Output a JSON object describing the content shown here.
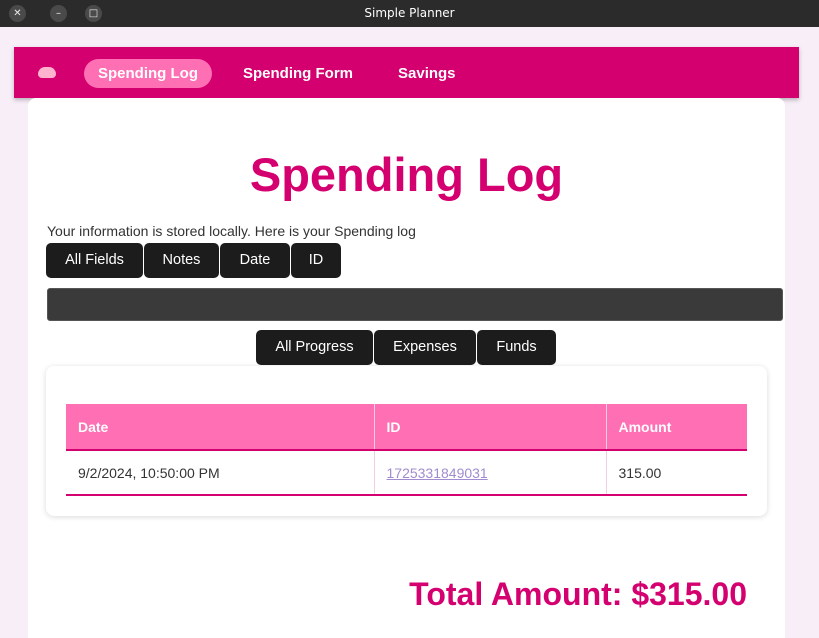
{
  "window": {
    "title": "Simple Planner",
    "close_glyph": "✕",
    "minimize_glyph": "–",
    "maximize_glyph": "□"
  },
  "nav": {
    "logo_icon": "piggy-bank-icon",
    "items": [
      {
        "label": "Spending Log",
        "active": true
      },
      {
        "label": "Spending Form",
        "active": false
      },
      {
        "label": "Savings",
        "active": false
      }
    ]
  },
  "page": {
    "title": "Spending Log",
    "info_text": "Your information is stored locally. Here is your Spending log"
  },
  "field_filters": [
    "All Fields",
    "Notes",
    "Date",
    "ID"
  ],
  "search": {
    "placeholder": ""
  },
  "type_filters": [
    "All Progress",
    "Expenses",
    "Funds"
  ],
  "table": {
    "headers": [
      "Date",
      "ID",
      "Amount"
    ],
    "rows": [
      {
        "date": "9/2/2024, 10:50:00 PM",
        "id": "1725331849031",
        "amount": "315.00"
      }
    ]
  },
  "total": "Total Amount: $315.00",
  "colors": {
    "brand": "#d4006f",
    "accent": "#ff6fb4",
    "button": "#1c1c1c"
  }
}
